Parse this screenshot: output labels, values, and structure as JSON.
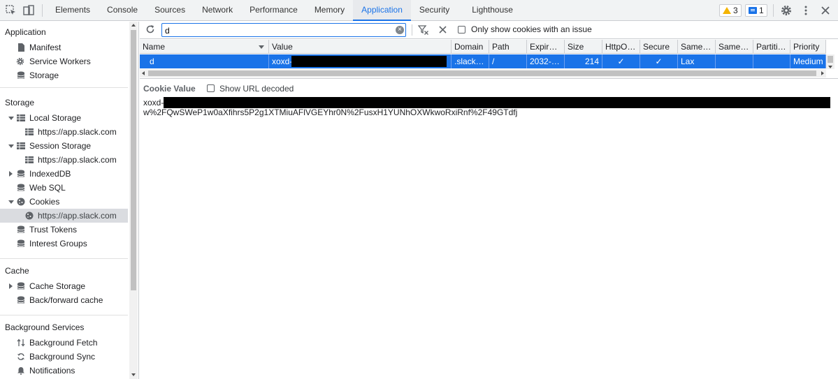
{
  "tabs": [
    "Elements",
    "Console",
    "Sources",
    "Network",
    "Performance",
    "Memory",
    "Application",
    "Security",
    "Lighthouse"
  ],
  "active_tab": "Application",
  "badges": {
    "warnings": "3",
    "messages": "1"
  },
  "sidebar": {
    "application_title": "Application",
    "application_items": [
      "Manifest",
      "Service Workers",
      "Storage"
    ],
    "storage_title": "Storage",
    "local_storage": "Local Storage",
    "local_storage_child": "https://app.slack.com",
    "session_storage": "Session Storage",
    "session_storage_child": "https://app.slack.com",
    "indexeddb": "IndexedDB",
    "websql": "Web SQL",
    "cookies": "Cookies",
    "cookies_child": "https://app.slack.com",
    "trust_tokens": "Trust Tokens",
    "interest_groups": "Interest Groups",
    "cache_title": "Cache",
    "cache_storage": "Cache Storage",
    "bfcache": "Back/forward cache",
    "bg_title": "Background Services",
    "bg_fetch": "Background Fetch",
    "bg_sync": "Background Sync",
    "notifications": "Notifications"
  },
  "toolbar": {
    "filter_value": "d",
    "only_issues_label": "Only show cookies with an issue"
  },
  "table": {
    "headers": [
      "Name",
      "Value",
      "Domain",
      "Path",
      "Expir…",
      "Size",
      "HttpO…",
      "Secure",
      "Same…",
      "Same…",
      "Partiti…",
      "Priority"
    ],
    "row": [
      "d",
      "xoxd-",
      ".slack…",
      "/",
      "2032-…",
      "214",
      "✓",
      "✓",
      "Lax",
      "",
      "",
      "Medium"
    ]
  },
  "cookie_value": {
    "title": "Cookie Value",
    "show_decoded_label": "Show URL decoded",
    "line1_prefix": "xoxd-",
    "line2": "w%2FQwSWeP1w0aXfihrs5P2g1XTMiuAFlVGEYhr0N%2FusxH1YUNhOXWkwoRxiRnf%2F49GTdfj"
  }
}
